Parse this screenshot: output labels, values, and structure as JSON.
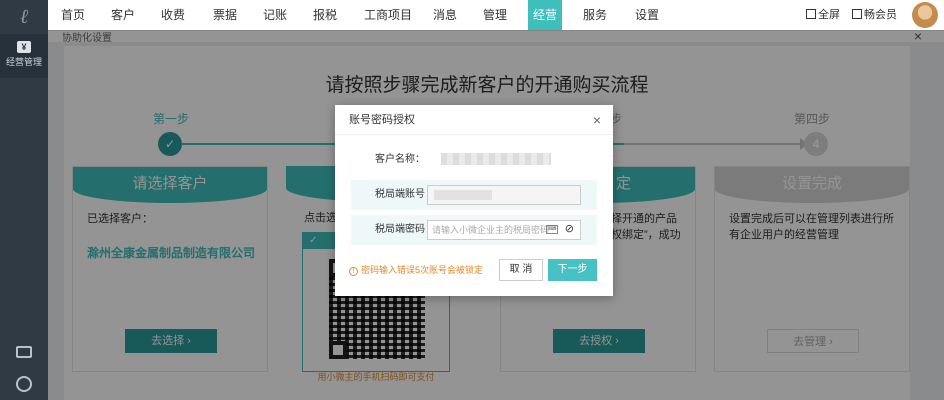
{
  "sidebar": {
    "logo_glyph": "ℓ",
    "active_item": {
      "icon": "yen-icon",
      "icon_text": "¥",
      "label": "经营管理"
    }
  },
  "topnav": {
    "items": [
      "首页",
      "客户",
      "收费",
      "票据",
      "记账",
      "报税",
      "工商项目",
      "消息",
      "管理",
      "经营",
      "服务",
      "设置"
    ],
    "active": "经营",
    "fullscreen": "全屏",
    "member": "畅会员"
  },
  "breadcrumb": {
    "text": "协助化设置",
    "close": "×"
  },
  "main": {
    "title": "请按照步骤完成新客户的开通购买流程",
    "steps": [
      {
        "label": "第一步",
        "dot": "✓"
      },
      {
        "label": "步"
      },
      {
        "label": "第四步",
        "dot": "4"
      }
    ],
    "cards": [
      {
        "head": "请选择客户",
        "text": "已选择客户：",
        "link": "滁州全康金属制品制造有限公司",
        "button": "去选择 ›"
      },
      {
        "text": "点击选择"
      },
      {
        "head": "定",
        "text": "择开通的产品 权绑定”，成功",
        "button": "去授权 ›"
      },
      {
        "head": "设置完成",
        "text": "设置完成后可以在管理列表进行所有企业用户的经营管理",
        "button": "去管理 ›"
      }
    ],
    "qr_caption": "用小微主的手机扫码即可支付"
  },
  "modal": {
    "title": "账号密码授权",
    "close": "×",
    "customer_label": "客户名称：",
    "account_label": "税局端账号",
    "password_label": "税局端密码",
    "password_placeholder": "请输入小微企业主的税局密码",
    "warning": "密码输入错误5次账号会被锁定",
    "cancel": "取 消",
    "next": "下一步"
  },
  "colors": {
    "accent": "#3ebfbc",
    "accent_dark": "#2a9a9a",
    "sidebar": "#2f3a45",
    "warning": "#e08a2b"
  }
}
